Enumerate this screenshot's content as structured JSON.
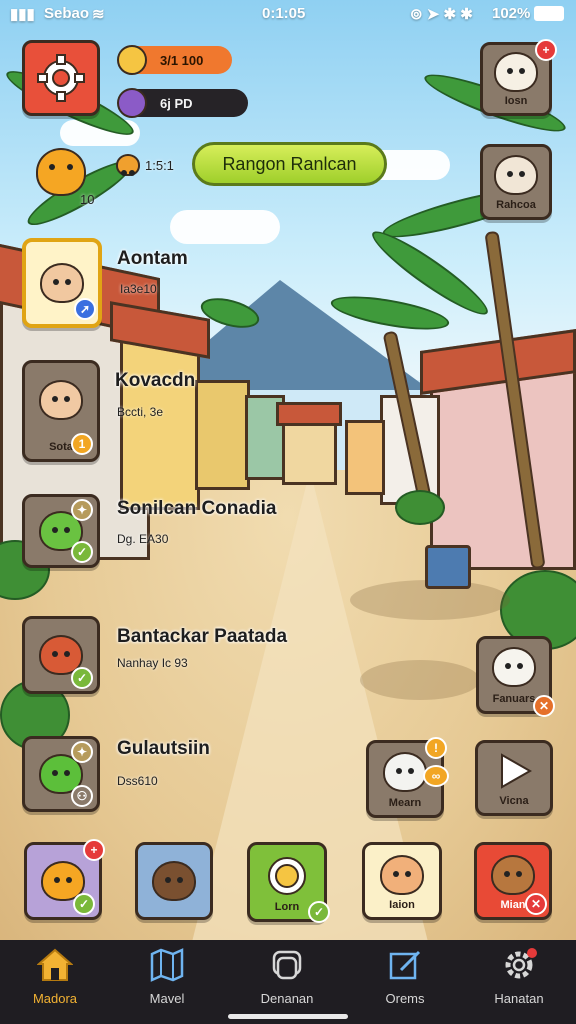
{
  "status_bar": {
    "carrier": "Sebao",
    "time": "0:1:05",
    "battery": "102%"
  },
  "resources": {
    "gold_value": "3/1 100",
    "gems_value": "6j PD",
    "energy_value": "1:5:1",
    "level_value": "10"
  },
  "main_action": {
    "label": "Rangon Ranlcan"
  },
  "right_tiles": [
    {
      "label": "Iosn"
    },
    {
      "label": "Rahcoa"
    },
    {
      "label": "Fanuars"
    },
    {
      "label": "Vicna"
    },
    {
      "label": "Mearn"
    }
  ],
  "characters": [
    {
      "name": "Aontam",
      "sub": "Ia3e10"
    },
    {
      "name": "Kovacdn",
      "sub": "Bccti, 3e",
      "tile_label": "Sota",
      "badge": "1"
    },
    {
      "name": "Sonilcan Conadia",
      "sub": "Dg. EA30"
    },
    {
      "name": "Bantackar Paatada",
      "sub": "Nanhay   Ic 93"
    },
    {
      "name": "Gulautsiin",
      "sub": "Dss610"
    }
  ],
  "hotbar": [
    {
      "label": ""
    },
    {
      "label": ""
    },
    {
      "label": "Lorn"
    },
    {
      "label": "Iaion"
    },
    {
      "label": "Mian"
    }
  ],
  "nav": [
    {
      "label": "Madora",
      "icon": "house-icon",
      "active": true
    },
    {
      "label": "Mavel",
      "icon": "map-icon"
    },
    {
      "label": "Denanan",
      "icon": "layers-icon"
    },
    {
      "label": "Orems",
      "icon": "edit-icon"
    },
    {
      "label": "Hanatan",
      "icon": "gear-icon"
    }
  ],
  "colors": {
    "accent_orange": "#f0782e",
    "nav_active": "#f2b233",
    "main_button": "#b5de39",
    "badge_red": "#e53a3a"
  }
}
